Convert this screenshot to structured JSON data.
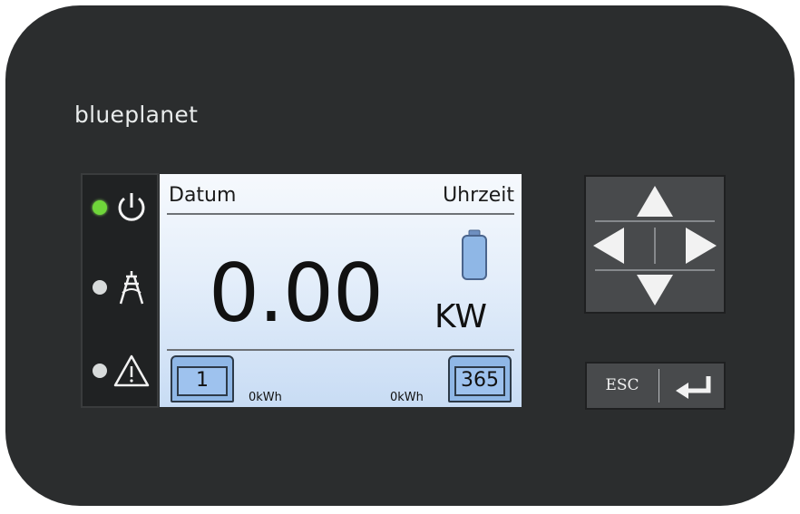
{
  "brand": {
    "name": "blueplanet"
  },
  "status_leds": [
    {
      "id": "power",
      "state": "on",
      "icon": "power-icon"
    },
    {
      "id": "grid",
      "state": "off",
      "icon": "grid-tower-icon"
    },
    {
      "id": "fault",
      "state": "off",
      "icon": "warning-icon"
    }
  ],
  "screen": {
    "header": {
      "date_label": "Datum",
      "time_label": "Uhrzeit"
    },
    "power": {
      "value": "0.00",
      "unit": "KW"
    },
    "battery_icon": "battery-icon",
    "counters": {
      "left": {
        "value": "1",
        "energy": "0kWh"
      },
      "right": {
        "value": "365",
        "energy": "0kWh"
      }
    }
  },
  "navigation": {
    "up": "arrow-up-icon",
    "down": "arrow-down-icon",
    "left": "arrow-left-icon",
    "right": "arrow-right-icon"
  },
  "buttons": {
    "esc_label": "ESC",
    "enter_icon": "enter-icon"
  },
  "colors": {
    "housing": "#2b2d2e",
    "led_on": "#6fd63a",
    "led_off": "#d8dbdb",
    "screen_bg": "#dce8f8",
    "counter_fill": "#8fb7e6"
  }
}
